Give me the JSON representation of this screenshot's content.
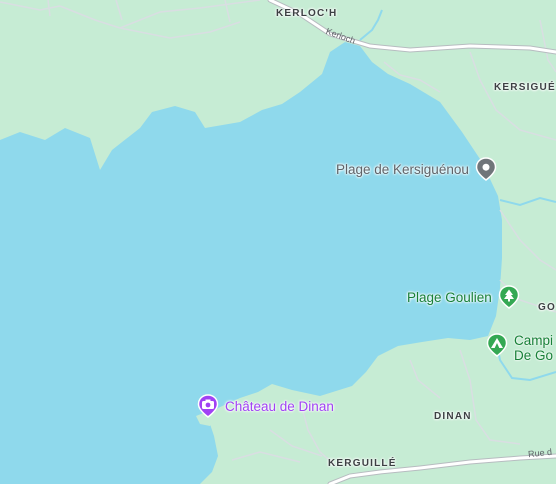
{
  "map": {
    "colors": {
      "land": "#c6ecd4",
      "water": "#8fd9ec",
      "road": "#ffffff",
      "road_border": "#b7bcc0",
      "stream": "#8fd9ec"
    },
    "places": {
      "kerloch": "KERLOC'H",
      "kersiguenou": "KERSIGUÉ",
      "goulien_edge": "GO",
      "dinan": "DINAN",
      "kerguille": "KERGUILLÉ"
    },
    "roads": {
      "kerloch_road": "Kerloch",
      "rue_edge": "Rue d"
    },
    "pois": {
      "plage_kersiguenou": {
        "label": "Plage de Kersiguénou",
        "icon": "pin-icon",
        "color": "#70757a"
      },
      "plage_goulien": {
        "label": "Plage Goulien",
        "icon": "tree-icon",
        "color": "#34a853"
      },
      "camping": {
        "label_line1": "Campi",
        "label_line2": "De Go",
        "icon": "tent-icon",
        "color": "#34a853"
      },
      "chateau_dinan": {
        "label": "Château de Dinan",
        "icon": "camera-icon",
        "color": "#a142f4"
      }
    }
  }
}
